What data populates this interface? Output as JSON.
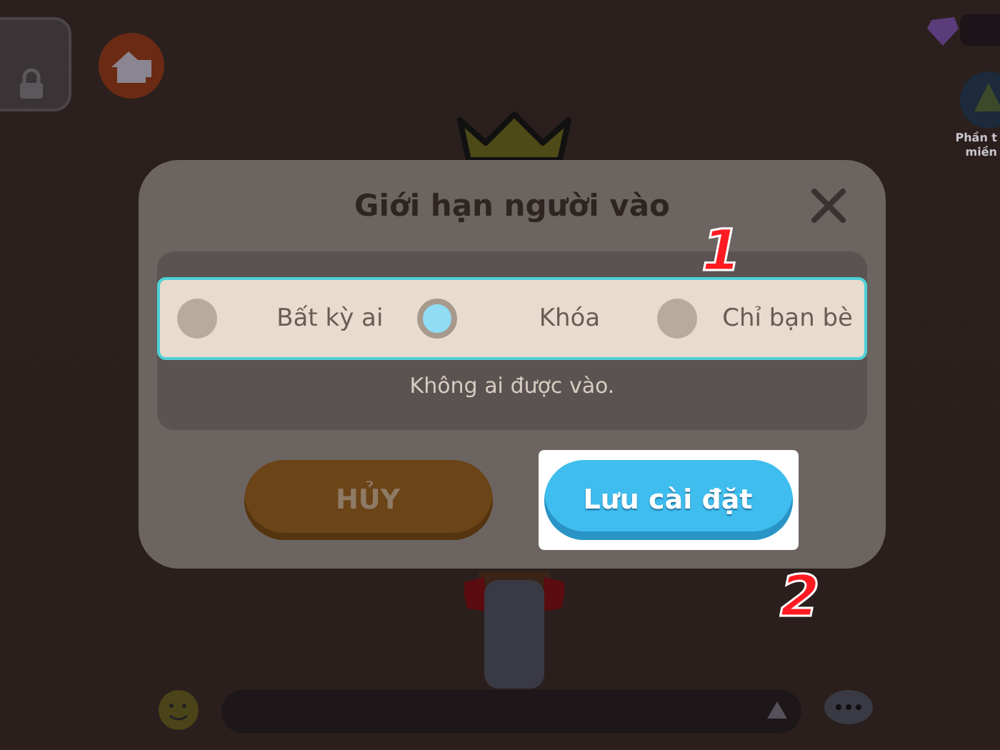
{
  "corner_badge": {
    "lines": [
      "Phần t",
      "miền"
    ]
  },
  "dialog": {
    "title": "Giới hạn người vào",
    "options_highlighted": true,
    "options": [
      {
        "label": "Bất kỳ ai",
        "selected": false
      },
      {
        "label": "Khóa",
        "selected": true
      },
      {
        "label": "Chỉ bạn bè",
        "selected": false
      }
    ],
    "description": "Không ai được vào.",
    "buttons": [
      {
        "label": "HỦY",
        "kind": "cancel",
        "highlighted": false
      },
      {
        "label": "Lưu cài đặt",
        "kind": "save",
        "highlighted": true
      }
    ]
  },
  "annotations": [
    {
      "label": "1"
    },
    {
      "label": "2"
    }
  ]
}
